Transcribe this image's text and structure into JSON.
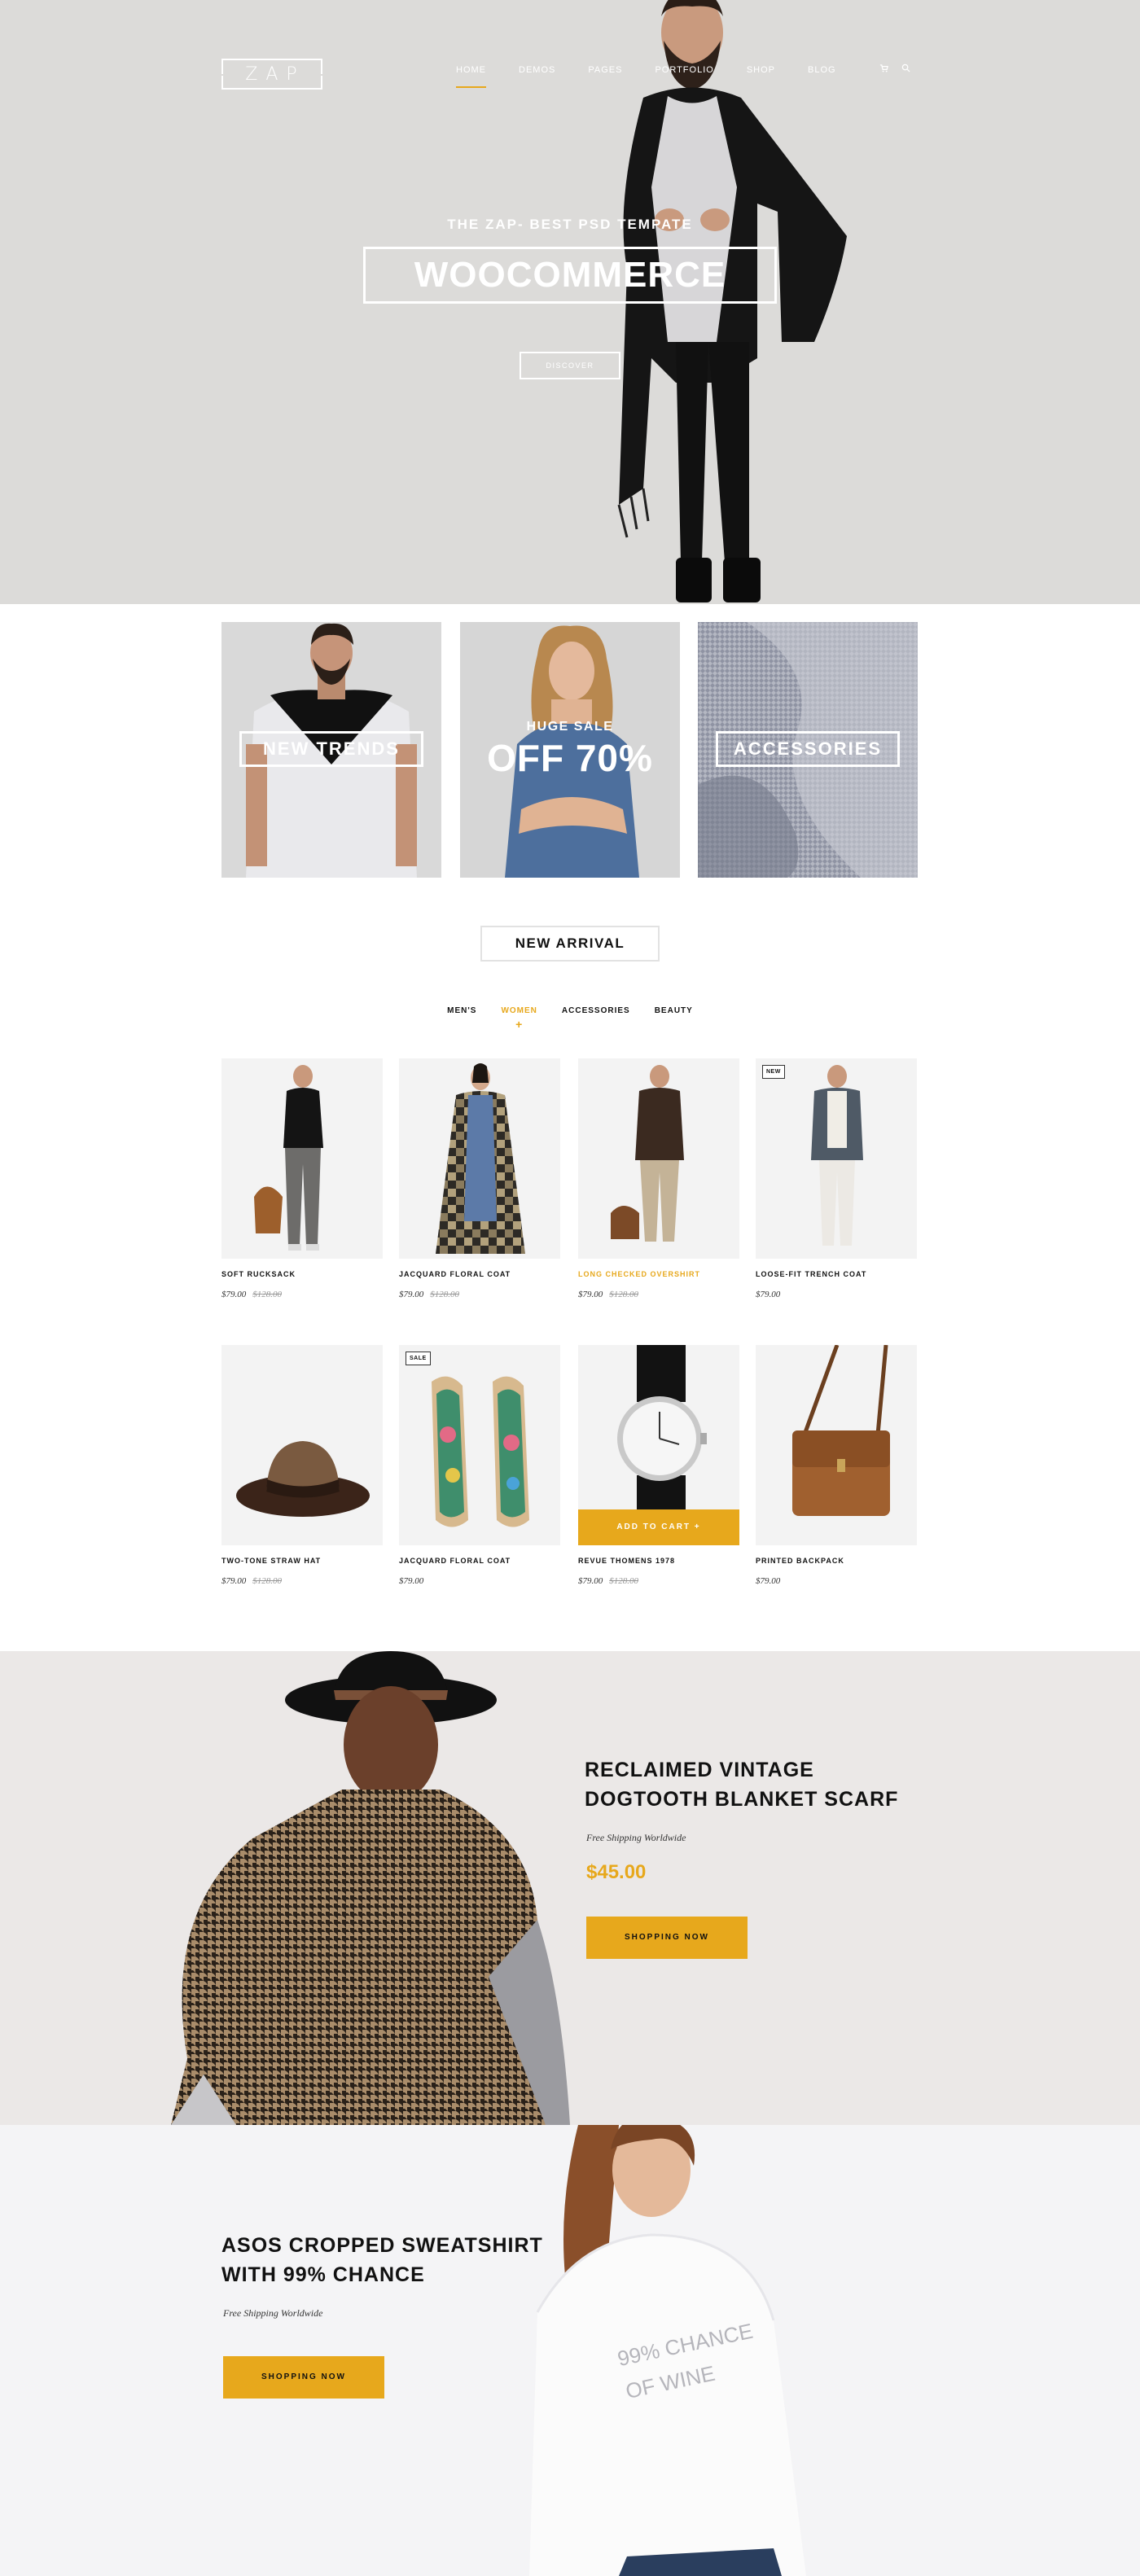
{
  "brand": {
    "logo_text": "ZAP"
  },
  "nav": {
    "items": [
      {
        "label": "HOME",
        "active": true
      },
      {
        "label": "DEMOS",
        "active": false
      },
      {
        "label": "PAGES",
        "active": false
      },
      {
        "label": "PORTFOLIO",
        "active": false
      },
      {
        "label": "SHOP",
        "active": false
      },
      {
        "label": "BLOG",
        "active": false
      }
    ],
    "cart_icon": "cart-icon",
    "search_icon": "search-icon"
  },
  "hero": {
    "eyebrow": "THE ZAP- BEST PSD TEMPATE",
    "title": "WOOCOMMERCE",
    "cta": "DISCOVER"
  },
  "banners": {
    "left_label": "NEW TRENDS",
    "middle_eyebrow": "HUGE SALE",
    "middle_big": "OFF 70%",
    "right_label": "ACCESSORIES"
  },
  "new_arrival": {
    "title": "NEW ARRIVAL",
    "filters": [
      {
        "label": "MEN'S",
        "active": false
      },
      {
        "label": "WOMEN",
        "active": true
      },
      {
        "label": "ACCESSORIES",
        "active": false
      },
      {
        "label": "BEAUTY",
        "active": false
      }
    ],
    "products": [
      {
        "name": "SOFT RUCKSACK",
        "price": "$79.00",
        "old_price": "$128.00"
      },
      {
        "name": "JACQUARD FLORAL COAT",
        "price": "$79.00",
        "old_price": "$128.00"
      },
      {
        "name": "LONG CHECKED OVERSHIRT",
        "price": "$79.00",
        "old_price": "$128.00"
      },
      {
        "name": "LOOSE-FIT TRENCH COAT",
        "price": "$79.00",
        "old_price": "",
        "tag": "NEW"
      },
      {
        "name": "TWO-TONE STRAW HAT",
        "price": "$79.00",
        "old_price": "$128.00"
      },
      {
        "name": "JACQUARD FLORAL COAT",
        "price": "$79.00",
        "old_price": "",
        "tag": "SALE"
      },
      {
        "name": "REVUE THOMENS 1978",
        "price": "$79.00",
        "old_price": "$128.00",
        "cta": "ADD TO CART +"
      },
      {
        "name": "PRINTED BACKPACK",
        "price": "$79.00",
        "old_price": ""
      }
    ]
  },
  "promo_scarf": {
    "title_line1": "RECLAIMED VINTAGE",
    "title_line2": "DOGTOOTH BLANKET SCARF",
    "subtitle": "Free Shipping Worldwide",
    "price": "$45.00",
    "cta": "SHOPPING NOW"
  },
  "promo_sweatshirt": {
    "title_line1": "ASOS CROPPED SWEATSHIRT",
    "title_line2": "WITH 99% CHANCE",
    "subtitle": "Free Shipping Worldwide",
    "cta": "SHOPPING NOW",
    "print_line1": "99% CHANCE",
    "print_line2": "OF WINE"
  },
  "colors": {
    "accent": "#e7a81c",
    "hero_bg": "#dcdbd9",
    "promo1_bg": "#ebe8e7",
    "promo2_bg": "#f4f4f6"
  }
}
